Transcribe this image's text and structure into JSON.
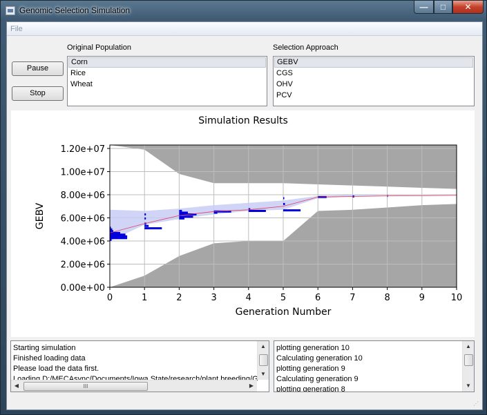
{
  "window": {
    "title": "Genomic Selection Simulation"
  },
  "titlebar_buttons": {
    "minimize": "—",
    "maximize": "□",
    "close": "✕"
  },
  "menu": {
    "file": "File"
  },
  "controls": {
    "pause": "Pause",
    "stop": "Stop"
  },
  "original_population": {
    "label": "Original Population",
    "items": [
      "Corn",
      "Rice",
      "Wheat"
    ],
    "selected": "Corn"
  },
  "selection_approach": {
    "label": "Selection Approach",
    "items": [
      "GEBV",
      "CGS",
      "OHV",
      "PCV"
    ],
    "selected": "GEBV"
  },
  "chart_data": {
    "type": "line",
    "title": "Simulation Results",
    "xlabel": "Generation Number",
    "ylabel": "GEBV",
    "xlim": [
      0,
      10
    ],
    "ylim": [
      0,
      12300000
    ],
    "xticks": [
      "0",
      "1",
      "2",
      "3",
      "4",
      "5",
      "6",
      "7",
      "8",
      "9",
      "10"
    ],
    "yticks": [
      "0.00e+00",
      "2.00e+06",
      "4.00e+06",
      "6.00e+06",
      "8.00e+06",
      "1.00e+07",
      "1.20e+07"
    ],
    "ytick_values": [
      0,
      2000000,
      4000000,
      6000000,
      8000000,
      10000000,
      12000000
    ],
    "grid": true,
    "colors": {
      "envelope": "#a6a6a6",
      "band": "#c8ccf4",
      "mean_line": "#e0405a",
      "histogram": "#0000dd"
    },
    "envelope": {
      "x": [
        0,
        1,
        2,
        3,
        4,
        5,
        6,
        7,
        8,
        9,
        10
      ],
      "upper": [
        12300000,
        11900000,
        9800000,
        9000000,
        9000000,
        9000000,
        8900000,
        8800000,
        8700000,
        8600000,
        8500000
      ],
      "lower": [
        0,
        1000000,
        2700000,
        3800000,
        4000000,
        4000000,
        6600000,
        6700000,
        6900000,
        7100000,
        7200000
      ]
    },
    "band": {
      "x": [
        0,
        1,
        2,
        3,
        4,
        5,
        6,
        7,
        8,
        9,
        10
      ],
      "upper": [
        6700000,
        6600000,
        6800000,
        7100000,
        7300000,
        7500000,
        7900000,
        8000000,
        8000000,
        8000000,
        8000000
      ],
      "lower": [
        4000000,
        5400000,
        5900000,
        6300000,
        6600000,
        6700000,
        7700000,
        7850000,
        7950000,
        7950000,
        7950000
      ]
    },
    "mean_line": {
      "x": [
        0,
        1,
        2,
        3,
        4,
        5,
        6,
        7,
        8,
        9,
        10
      ],
      "y": [
        4700000,
        5500000,
        6200000,
        6550000,
        6700000,
        7000000,
        7800000,
        7850000,
        7900000,
        7920000,
        7950000
      ]
    },
    "histograms": [
      {
        "generation": 0,
        "bars": [
          {
            "value": 4100000,
            "width": 0.05
          },
          {
            "value": 4250000,
            "width": 0.5
          },
          {
            "value": 4400000,
            "width": 0.5
          },
          {
            "value": 4550000,
            "width": 0.45
          },
          {
            "value": 4700000,
            "width": 0.3
          },
          {
            "value": 4850000,
            "width": 0.1
          },
          {
            "value": 5000000,
            "width": 0.07
          },
          {
            "value": 5150000,
            "width": 0.03
          }
        ]
      },
      {
        "generation": 1,
        "bars": [
          {
            "value": 5100000,
            "width": 0.5
          },
          {
            "value": 5300000,
            "width": 0.12
          },
          {
            "value": 5500000,
            "width": 0.05
          },
          {
            "value": 5950000,
            "width": 0.04
          },
          {
            "value": 6300000,
            "width": 0.04
          }
        ]
      },
      {
        "generation": 2,
        "bars": [
          {
            "value": 5950000,
            "width": 0.15
          },
          {
            "value": 6100000,
            "width": 0.4
          },
          {
            "value": 6300000,
            "width": 0.5
          },
          {
            "value": 6450000,
            "width": 0.25
          },
          {
            "value": 6600000,
            "width": 0.08
          }
        ]
      },
      {
        "generation": 3,
        "bars": [
          {
            "value": 6450000,
            "width": 0.1
          },
          {
            "value": 6550000,
            "width": 0.5
          }
        ]
      },
      {
        "generation": 4,
        "bars": [
          {
            "value": 6600000,
            "width": 0.5
          },
          {
            "value": 6750000,
            "width": 0.05
          }
        ]
      },
      {
        "generation": 5,
        "bars": [
          {
            "value": 6650000,
            "width": 0.5
          },
          {
            "value": 7200000,
            "width": 0.05
          },
          {
            "value": 7700000,
            "width": 0.03
          }
        ]
      },
      {
        "generation": 6,
        "bars": [
          {
            "value": 7800000,
            "width": 0.25
          }
        ]
      },
      {
        "generation": 7,
        "bars": [
          {
            "value": 7850000,
            "width": 0.05
          }
        ]
      },
      {
        "generation": 8,
        "bars": [
          {
            "value": 7900000,
            "width": 0.02
          }
        ]
      }
    ]
  },
  "log_left": {
    "lines": [
      "Starting simulation",
      "Finished loading data",
      "Please load the data first.",
      "Loading D:/MECAsync/Documents/Iowa State/research/plant breeding/G"
    ],
    "hscroll_glyph": "III"
  },
  "log_right": {
    "lines": [
      "plotting generation 10",
      "Calculating generation 10",
      "plotting generation 9",
      "Calculating generation 9",
      "plotting generation 8"
    ]
  }
}
